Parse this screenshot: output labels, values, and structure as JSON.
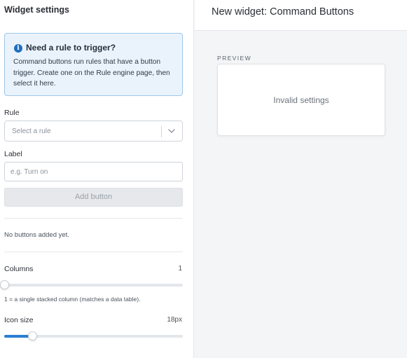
{
  "sidebar": {
    "title": "Widget settings",
    "info": {
      "icon": "info-icon",
      "title": "Need a rule to trigger?",
      "text_lines": [
        "Command buttons run rules that have a button",
        "trigger. Create one on the Rule engine page, then",
        "select it here."
      ]
    },
    "rule": {
      "label": "Rule",
      "placeholder": "Select a rule",
      "icon": "chevron-down-icon"
    },
    "label_field": {
      "label": "Label",
      "placeholder": "e.g. Turn on",
      "value": ""
    },
    "add_button_label": "Add button",
    "empty_text": "No buttons added yet.",
    "columns": {
      "label": "Columns",
      "value": "1",
      "hint": "1 = a single stacked column (matches a data table).",
      "fraction": 0.0
    },
    "icon_size": {
      "label": "Icon size",
      "value": "18px",
      "fraction": 0.155
    }
  },
  "main": {
    "title": "New widget: Command Buttons",
    "preview_label": "PREVIEW",
    "preview_message": "Invalid settings"
  },
  "colors": {
    "accent": "#2a7fd4",
    "info_bg": "#eaf3fb",
    "info_border": "#9cc8ec"
  }
}
